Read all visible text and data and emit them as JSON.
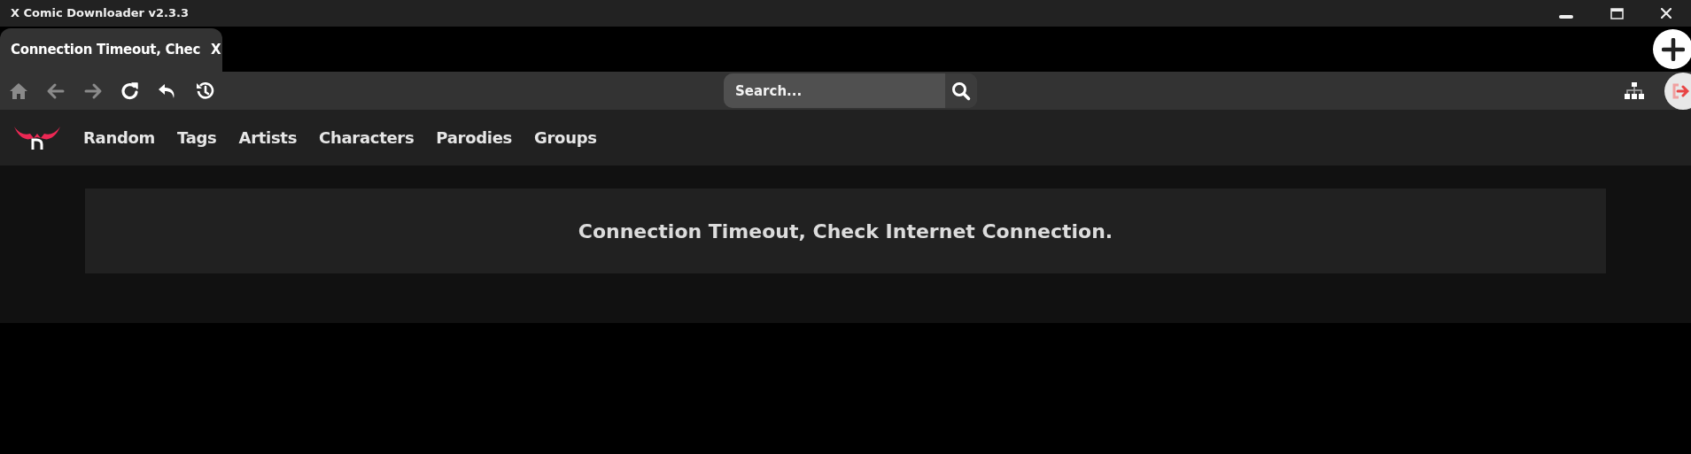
{
  "window": {
    "title": "X Comic Downloader v2.3.3"
  },
  "tabs": [
    {
      "label": "Connection Timeout, Chec",
      "close": "X",
      "selected": true
    }
  ],
  "toolbar": {
    "buttons": [
      {
        "kind": "home",
        "disabled": true
      },
      {
        "kind": "back",
        "disabled": true
      },
      {
        "kind": "forward",
        "disabled": true
      },
      {
        "kind": "reload",
        "disabled": false
      },
      {
        "kind": "undo",
        "disabled": false
      },
      {
        "kind": "history",
        "disabled": false
      }
    ]
  },
  "search": {
    "placeholder": "Search..."
  },
  "nav": {
    "links": [
      "Random",
      "Tags",
      "Artists",
      "Characters",
      "Parodies",
      "Groups"
    ]
  },
  "message": "Connection Timeout, Check Internet Connection."
}
